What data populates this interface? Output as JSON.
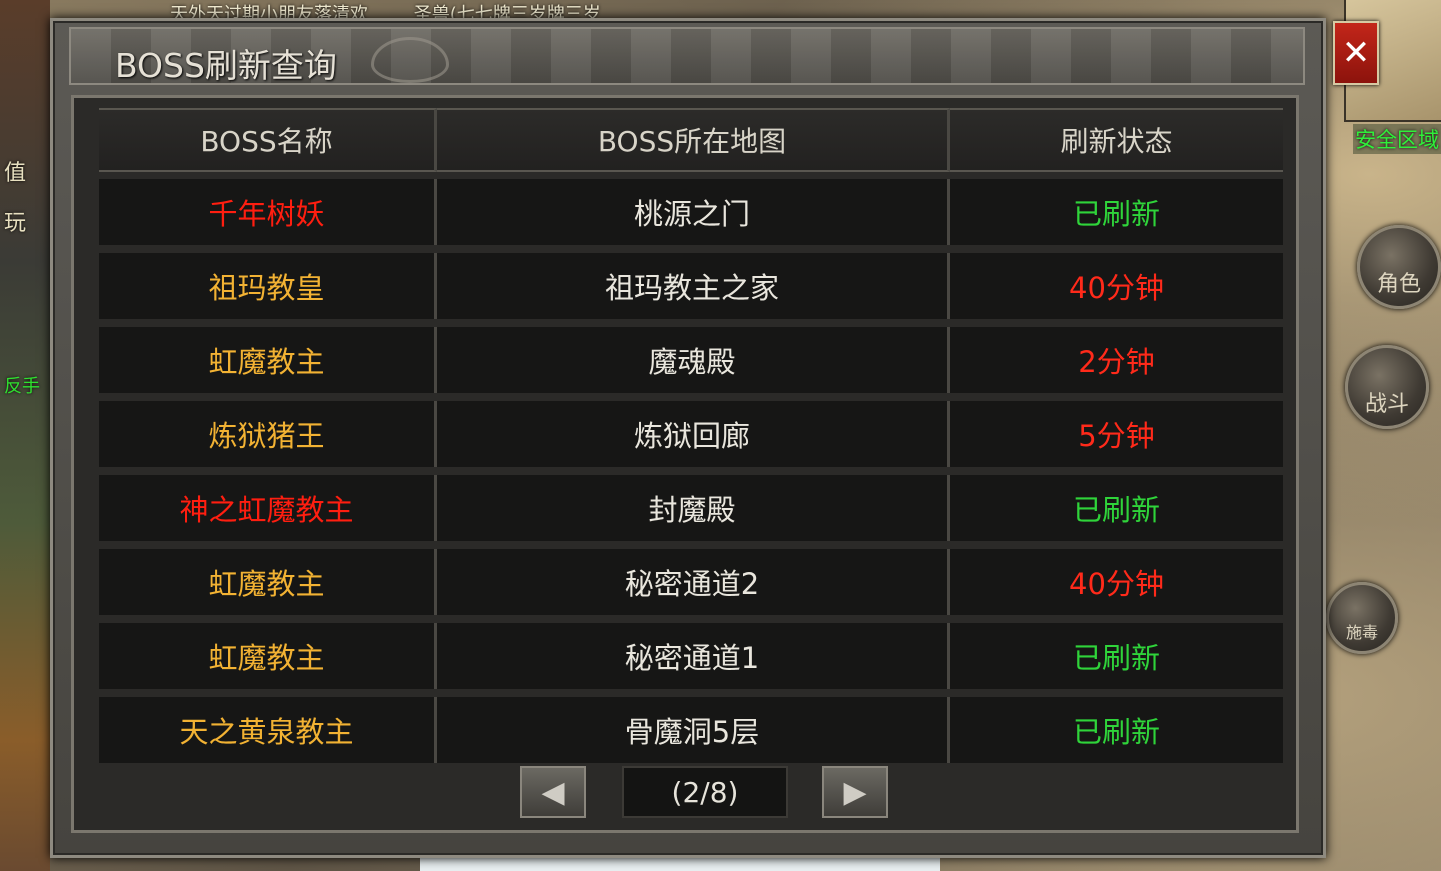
{
  "background": {
    "ticker_messages": [
      "天外天过期小朋友落清欢",
      "圣兽(七七牌三岁牌三岁"
    ],
    "left_labels": [
      "值",
      "玩",
      "反手"
    ],
    "safe_zone_label": "安全区域",
    "side_buttons": [
      "角色",
      "战斗",
      "施毒"
    ]
  },
  "dialog": {
    "title": "BOSS刷新查询",
    "close_label": "✕",
    "columns": [
      "BOSS名称",
      "BOSS所在地图",
      "刷新状态"
    ],
    "rows": [
      {
        "name": "千年树妖",
        "map": "桃源之门",
        "status": "已刷新"
      },
      {
        "name": "祖玛教皇",
        "map": "祖玛教主之家",
        "status": "40分钟"
      },
      {
        "name": "虹魔教主",
        "map": "魔魂殿",
        "status": "2分钟"
      },
      {
        "name": "炼狱猪王",
        "map": "炼狱回廊",
        "status": "5分钟"
      },
      {
        "name": "神之虹魔教主",
        "map": "封魔殿",
        "status": "已刷新"
      },
      {
        "name": "虹魔教主",
        "map": "秘密通道2",
        "status": "40分钟"
      },
      {
        "name": "虹魔教主",
        "map": "秘密通道1",
        "status": "已刷新"
      },
      {
        "name": "天之黄泉教主",
        "map": "骨魔洞5层",
        "status": "已刷新"
      }
    ],
    "pagination": {
      "prev_icon": "◀",
      "next_icon": "▶",
      "indicator": "(2/8)"
    }
  },
  "colors": {
    "status_refreshed": "#2fd43a",
    "status_pending": "#ff2a1a",
    "name_special": "#ff1e10",
    "name_normal": "#f2b233"
  }
}
